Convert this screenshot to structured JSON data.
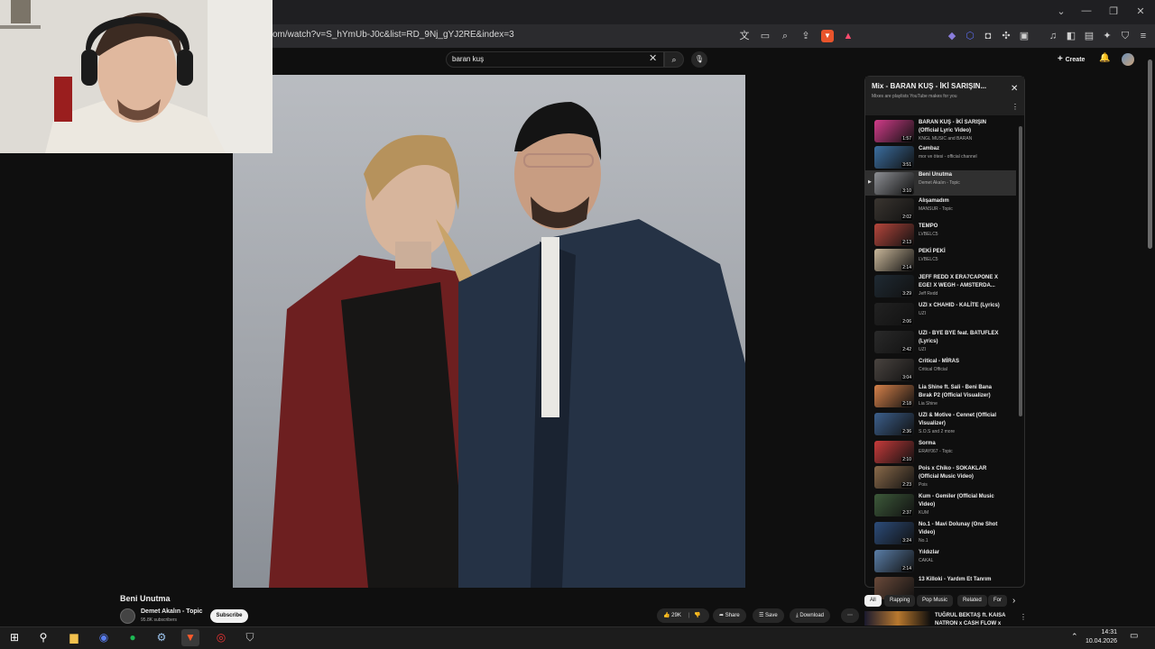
{
  "browser": {
    "url": "om/watch?v=S_hYmUb-J0c&list=RD_9Nj_gYJ2RE&index=3",
    "shield_badge": "19"
  },
  "youtube": {
    "search_value": "baran kuş",
    "create_label": "Create"
  },
  "video": {
    "title": "Beni Unutma",
    "channel": "Demet Akalın - Topic",
    "subscribers": "95.8K subscribers",
    "subscribe_label": "Subscribe",
    "likes": "29K",
    "share_label": "Share",
    "save_label": "Save",
    "download_label": "Download"
  },
  "playlist": {
    "title": "Mix - BARAN KUŞ - İKİ SARIŞIN...",
    "subtitle": "Mixes are playlists YouTube makes for you",
    "items": [
      {
        "title": "BARAN KUŞ - İKİ SARIŞIN (Official Lyric Video)",
        "channel": "KNGL MUSIC and BARAN",
        "duration": "1:57",
        "color": "#d23c8a"
      },
      {
        "title": "Cambaz",
        "channel": "mor ve ötesi - official channel",
        "duration": "3:51",
        "color": "#3b6ea0"
      },
      {
        "title": "Beni Unutma",
        "channel": "Demet Akalın - Topic",
        "duration": "3:10",
        "color": "#8d8f94",
        "active": true
      },
      {
        "title": "Alışamadım",
        "channel": "MANSUR - Topic",
        "duration": "2:02",
        "color": "#3a3530"
      },
      {
        "title": "TEMPO",
        "channel": "LVBELC5",
        "duration": "2:13",
        "color": "#b6463c"
      },
      {
        "title": "PEKİ PEKİ",
        "channel": "LVBELC5",
        "duration": "2:14",
        "color": "#c9b79a"
      },
      {
        "title": "JEFF REDD X ERA7CAPONE X EGE! X WEGH - AMSTERDA...",
        "channel": "Jeff Redd",
        "duration": "3:29",
        "color": "#1f2a33"
      },
      {
        "title": "UZI x CHAHID - KALİTE (Lyrics)",
        "channel": "UZI",
        "duration": "2:06",
        "color": "#222222"
      },
      {
        "title": "UZI - BYE BYE feat. BATUFLEX (Lyrics)",
        "channel": "UZI",
        "duration": "2:42",
        "color": "#2a2a2a"
      },
      {
        "title": "Critical - MİRAS",
        "channel": "Critical Official",
        "duration": "3:04",
        "color": "#4a4440"
      },
      {
        "title": "Lia Shine ft. Sali - Beni Bana Bırak P2 (Official Visualizer)",
        "channel": "Lia Shine",
        "duration": "2:18",
        "color": "#d6814a"
      },
      {
        "title": "UZI & Motive - Cennet (Official Visualizer)",
        "channel": "S.O.S and 2 more",
        "duration": "2:36",
        "color": "#3c5f8c"
      },
      {
        "title": "Sorma",
        "channel": "ERAY067 - Topic",
        "duration": "2:10",
        "color": "#c73b3b"
      },
      {
        "title": "Pois x Chiko - SOKAKLAR (Official Music Video)",
        "channel": "Pois",
        "duration": "2:23",
        "color": "#8a6a4a"
      },
      {
        "title": "Kum - Gemiler (Official Music Video)",
        "channel": "KUM",
        "duration": "2:37",
        "color": "#3d5a3a"
      },
      {
        "title": "No.1 - Mavi Dolunay (One Shot Video)",
        "channel": "No.1",
        "duration": "3:24",
        "color": "#2c4c7a"
      },
      {
        "title": "Yıldızlar",
        "channel": "CAKAL",
        "duration": "2:14",
        "color": "#5a7ea8"
      },
      {
        "title": "13 Killoki - Yardım Et Tanrım",
        "channel": "",
        "duration": "",
        "color": "#6a4a3a"
      }
    ]
  },
  "chips": [
    "All",
    "Rapping",
    "Pop Music",
    "Related",
    "For"
  ],
  "related": {
    "title_line1": "TUĞRUL BEKTAŞ ft. KAISA",
    "title_line2": "NATRON x CASH FLOW x"
  },
  "taskbar": {
    "time": "14:31",
    "date": "10.04.2026"
  }
}
